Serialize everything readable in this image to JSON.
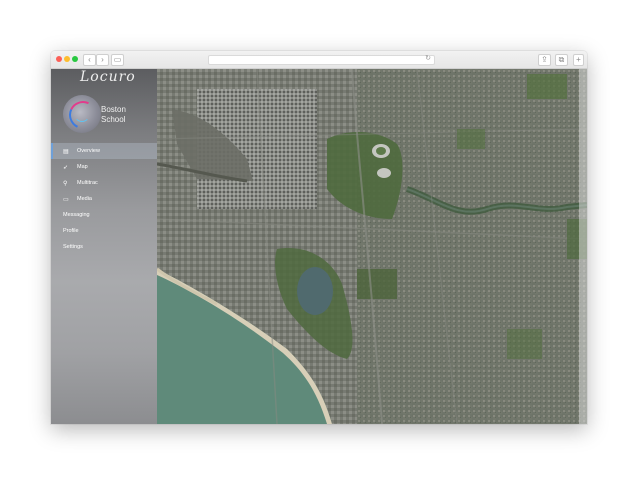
{
  "app": {
    "logo_text": "Locuro",
    "school_name_line1": "Boston",
    "school_name_line2": "School"
  },
  "nav": {
    "items": [
      {
        "label": "Overview",
        "icon": "grid-icon",
        "active": true
      },
      {
        "label": "Map",
        "icon": "map-pin-icon",
        "active": false
      },
      {
        "label": "Multitrac",
        "icon": "search-icon",
        "active": false
      },
      {
        "label": "Media",
        "icon": "image-icon",
        "active": false
      },
      {
        "label": "Messaging",
        "icon": "",
        "active": false
      },
      {
        "label": "Profile",
        "icon": "",
        "active": false
      },
      {
        "label": "Settings",
        "icon": "",
        "active": false
      }
    ]
  },
  "map": {
    "type": "satellite",
    "colors": {
      "water": "#5f8a7a",
      "beach": "#d8cfb8",
      "park": "#4f6a3e",
      "urban": "#7d7f78"
    }
  },
  "colors": {
    "active_accent": "#6fa0d8"
  }
}
